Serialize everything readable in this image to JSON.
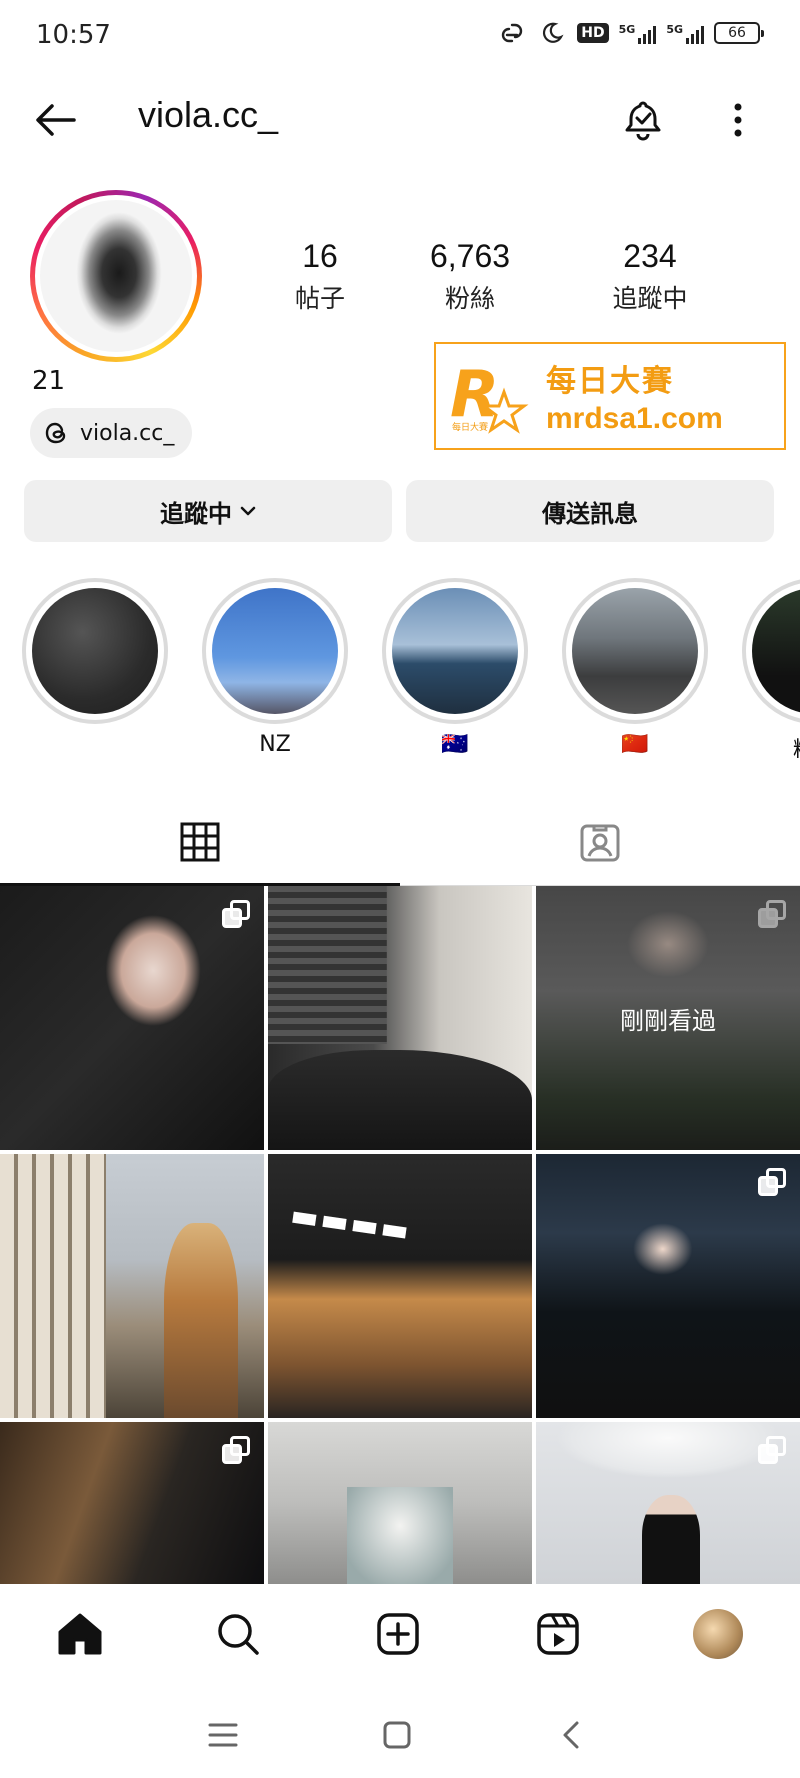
{
  "status_bar": {
    "time": "10:57",
    "network_label_1": "5G",
    "network_label_2": "5G",
    "hd_label": "HD",
    "battery": "66"
  },
  "header": {
    "username": "viola.cc_"
  },
  "profile": {
    "stats": [
      {
        "value": "16",
        "label": "帖子"
      },
      {
        "value": "6,763",
        "label": "粉絲"
      },
      {
        "value": "234",
        "label": "追蹤中"
      }
    ],
    "bio_name": "21",
    "threads_handle": "viola.cc_"
  },
  "watermark": {
    "title": "每日大賽",
    "url": "mrdsa1.com",
    "logo_small_text": "每日大賽"
  },
  "actions": {
    "follow_label": "追蹤中",
    "message_label": "傳送訊息"
  },
  "highlights": [
    {
      "label": ""
    },
    {
      "label": "NZ"
    },
    {
      "label": "🇦🇺"
    },
    {
      "label": "🇨🇳"
    },
    {
      "label": "精選"
    }
  ],
  "grid": {
    "recent_label": "剛剛看過",
    "posts": [
      {
        "multi": true
      },
      {
        "multi": false
      },
      {
        "multi": true,
        "recent": true
      },
      {
        "multi": false
      },
      {
        "multi": false
      },
      {
        "multi": true
      },
      {
        "multi": true
      },
      {
        "multi": false
      },
      {
        "multi": true
      }
    ]
  },
  "icons": {
    "back": "arrow-left-icon",
    "bell": "bell-check-icon",
    "more": "more-vertical-icon",
    "threads": "threads-icon",
    "grid": "grid-icon",
    "tagged": "tagged-icon",
    "home": "home-icon",
    "search": "search-icon",
    "create": "plus-square-icon",
    "reels": "reels-icon"
  }
}
